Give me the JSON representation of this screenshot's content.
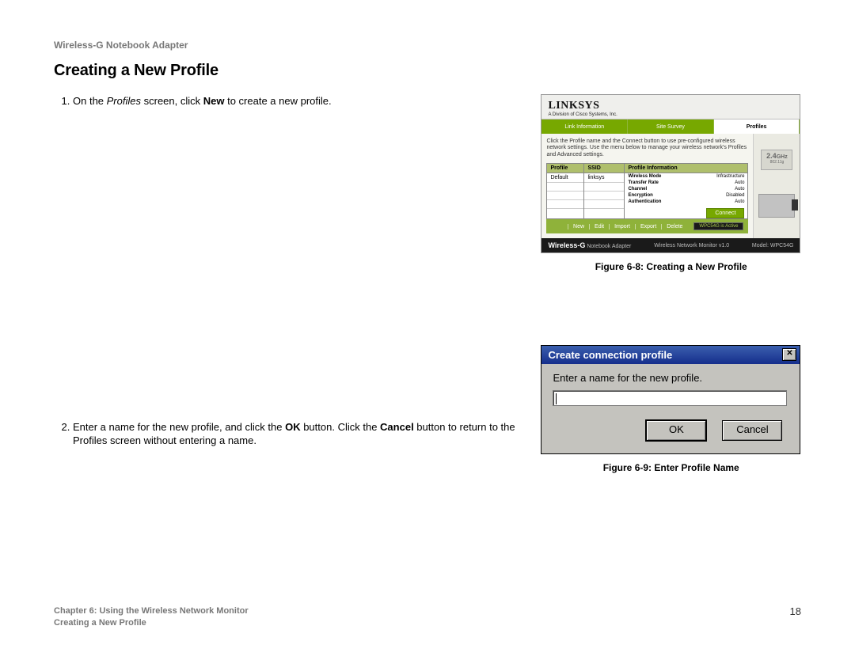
{
  "header": {
    "product": "Wireless-G Notebook Adapter"
  },
  "section": {
    "title": "Creating a New Profile"
  },
  "steps": {
    "s1_pre": "On the ",
    "s1_em": "Profiles",
    "s1_mid": " screen, click ",
    "s1_bold": "New",
    "s1_post": " to create a new profile.",
    "s2_pre": "Enter a name for the new profile, and click the ",
    "s2_b1": "OK",
    "s2_mid": " button. Click the ",
    "s2_b2": "Cancel",
    "s2_post": " button to return to the Profiles screen without entering a name."
  },
  "fig8": {
    "caption": "Figure 6-8: Creating a New Profile",
    "brand": "LINKSYS",
    "brand_sub": "A Division of Cisco Systems, Inc.",
    "tabs": {
      "t1": "Link Information",
      "t2": "Site Survey",
      "t3": "Profiles"
    },
    "instr": "Click the Profile name and the Connect button to use pre-configured wireless network settings. Use the menu below to manage your wireless network's Profiles and Advanced settings.",
    "cols": {
      "profile": "Profile",
      "ssid": "SSID",
      "info": "Profile Information"
    },
    "row": {
      "profile": "Default",
      "ssid": "linksys"
    },
    "info": {
      "mode_l": "Wireless Mode",
      "mode_v": "Infrastructure",
      "rate_l": "Transfer Rate",
      "rate_v": "Auto",
      "chan_l": "Channel",
      "chan_v": "Auto",
      "enc_l": "Encryption",
      "enc_v": "Disabled",
      "auth_l": "Authentication",
      "auth_v": "Auto"
    },
    "connect": "Connect",
    "btns": {
      "b1": "New",
      "b2": "Edit",
      "b3": "Import",
      "b4": "Export",
      "b5": "Delete"
    },
    "status": "WPC54G is Active",
    "foot_left_a": "Wireless-",
    "foot_left_b": "G",
    "foot_left_c": " Notebook Adapter",
    "foot_mid": "Wireless Network Monitor v1.0",
    "foot_right": "Model: WPC54G",
    "ghz": "2.4",
    "ghz_unit": "GHz",
    "ghz_std": "802.11g"
  },
  "fig9": {
    "caption": "Figure 6-9: Enter Profile Name",
    "title": "Create connection profile",
    "label": "Enter a name for the new profile.",
    "ok": "OK",
    "cancel": "Cancel"
  },
  "footer": {
    "line1": "Chapter 6: Using the Wireless Network Monitor",
    "line2": "Creating a New Profile",
    "page": "18"
  }
}
